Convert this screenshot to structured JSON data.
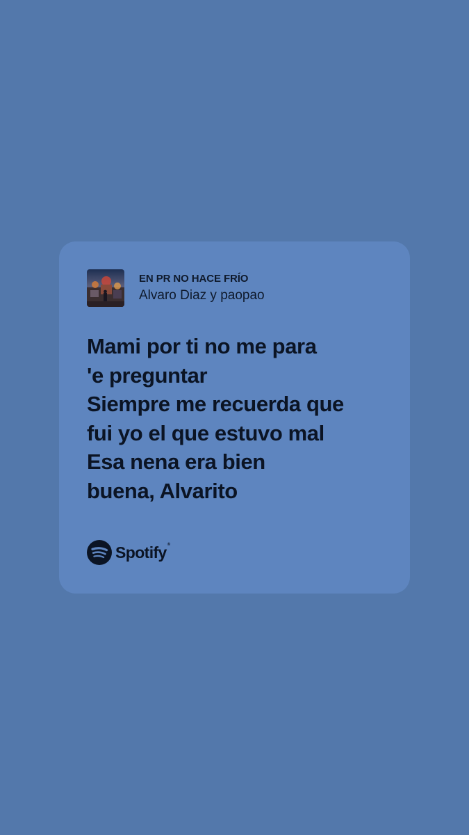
{
  "background_color": "#5378ab",
  "card_color": "#5e85bf",
  "track": {
    "title": "EN PR NO HACE FRÍO",
    "artist": "Alvaro Diaz y paopao",
    "cover_icon": "album-cover-image"
  },
  "lyrics": [
    "Mami por ti no me para",
    "'e preguntar",
    "Siempre me recuerda que",
    "fui yo el que estuvo mal",
    "Esa nena era bien",
    "buena, Alvarito"
  ],
  "brand": {
    "name": "Spotify",
    "icon": "spotify-logo-icon",
    "trademark": "®"
  }
}
